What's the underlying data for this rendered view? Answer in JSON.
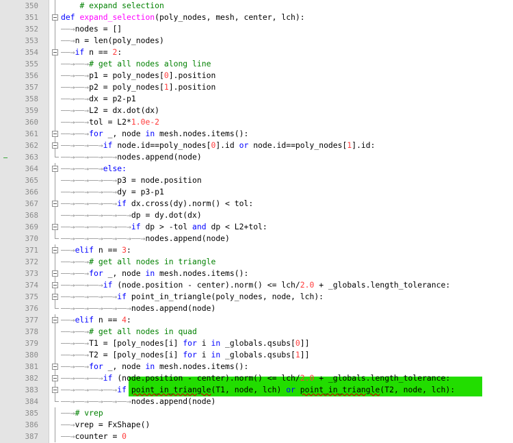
{
  "editor": {
    "lines": [
      {
        "n": "350",
        "fold": "line",
        "tokens": [
          {
            "t": "    ",
            "c": "tx"
          },
          {
            "t": "# expand selection",
            "c": "cm"
          }
        ]
      },
      {
        "n": "351",
        "fold": "box",
        "tokens": [
          {
            "t": "def ",
            "c": "kw"
          },
          {
            "t": "expand_selection",
            "c": "fn"
          },
          {
            "t": "(poly_nodes, mesh, center, lch):",
            "c": "tx"
          }
        ]
      },
      {
        "n": "352",
        "fold": "line",
        "tokens": [
          {
            "t": "——→",
            "c": "arrow"
          },
          {
            "t": "nodes = []",
            "c": "tx"
          }
        ]
      },
      {
        "n": "353",
        "fold": "line",
        "tokens": [
          {
            "t": "——→",
            "c": "arrow"
          },
          {
            "t": "n = len(poly_nodes)",
            "c": "tx"
          }
        ]
      },
      {
        "n": "354",
        "fold": "box",
        "tokens": [
          {
            "t": "——→",
            "c": "arrow"
          },
          {
            "t": "if ",
            "c": "kw"
          },
          {
            "t": "n == ",
            "c": "tx"
          },
          {
            "t": "2",
            "c": "num"
          },
          {
            "t": ":",
            "c": "tx"
          }
        ]
      },
      {
        "n": "355",
        "fold": "line",
        "tokens": [
          {
            "t": "——→——→",
            "c": "arrow"
          },
          {
            "t": "# get all nodes along line",
            "c": "cm"
          }
        ]
      },
      {
        "n": "356",
        "fold": "line",
        "tokens": [
          {
            "t": "——→——→",
            "c": "arrow"
          },
          {
            "t": "p1 = poly_nodes[",
            "c": "tx"
          },
          {
            "t": "0",
            "c": "num"
          },
          {
            "t": "].position",
            "c": "tx"
          }
        ]
      },
      {
        "n": "357",
        "fold": "line",
        "tokens": [
          {
            "t": "——→——→",
            "c": "arrow"
          },
          {
            "t": "p2 = poly_nodes[",
            "c": "tx"
          },
          {
            "t": "1",
            "c": "num"
          },
          {
            "t": "].position",
            "c": "tx"
          }
        ]
      },
      {
        "n": "358",
        "fold": "line",
        "tokens": [
          {
            "t": "——→——→",
            "c": "arrow"
          },
          {
            "t": "dx = p2-p1",
            "c": "tx"
          }
        ]
      },
      {
        "n": "359",
        "fold": "line",
        "tokens": [
          {
            "t": "——→——→",
            "c": "arrow"
          },
          {
            "t": "L2 = dx.dot(dx)",
            "c": "tx"
          }
        ]
      },
      {
        "n": "360",
        "fold": "line",
        "tokens": [
          {
            "t": "——→——→",
            "c": "arrow"
          },
          {
            "t": "tol = L2*",
            "c": "tx"
          },
          {
            "t": "1.0e-2",
            "c": "num"
          }
        ]
      },
      {
        "n": "361",
        "fold": "box",
        "tokens": [
          {
            "t": "——→——→",
            "c": "arrow"
          },
          {
            "t": "for ",
            "c": "kw"
          },
          {
            "t": "_, node ",
            "c": "tx"
          },
          {
            "t": "in ",
            "c": "kw"
          },
          {
            "t": "mesh.nodes.items():",
            "c": "tx"
          }
        ]
      },
      {
        "n": "362",
        "fold": "box",
        "tokens": [
          {
            "t": "——→——→——→",
            "c": "arrow"
          },
          {
            "t": "if ",
            "c": "kw"
          },
          {
            "t": "node.id==poly_nodes[",
            "c": "tx"
          },
          {
            "t": "0",
            "c": "num"
          },
          {
            "t": "].id ",
            "c": "tx"
          },
          {
            "t": "or ",
            "c": "kw"
          },
          {
            "t": "node.id==poly_nodes[",
            "c": "tx"
          },
          {
            "t": "1",
            "c": "num"
          },
          {
            "t": "].id:",
            "c": "tx"
          }
        ]
      },
      {
        "n": "363",
        "fold": "end",
        "tokens": [
          {
            "t": "——→——→——→——→",
            "c": "arrow"
          },
          {
            "t": "nodes.append(node)",
            "c": "tx"
          }
        ]
      },
      {
        "n": "364",
        "fold": "box",
        "tokens": [
          {
            "t": "——→——→——→",
            "c": "arrow"
          },
          {
            "t": "else:",
            "c": "kw"
          }
        ]
      },
      {
        "n": "365",
        "fold": "line",
        "tokens": [
          {
            "t": "——→——→——→——→",
            "c": "arrow"
          },
          {
            "t": "p3 = node.position",
            "c": "tx"
          }
        ]
      },
      {
        "n": "366",
        "fold": "line",
        "tokens": [
          {
            "t": "——→——→——→——→",
            "c": "arrow"
          },
          {
            "t": "dy = p3-p1",
            "c": "tx"
          }
        ]
      },
      {
        "n": "367",
        "fold": "box",
        "tokens": [
          {
            "t": "——→——→——→——→",
            "c": "arrow"
          },
          {
            "t": "if ",
            "c": "kw"
          },
          {
            "t": "dx.cross(dy).norm() < tol:",
            "c": "tx"
          }
        ]
      },
      {
        "n": "368",
        "fold": "line",
        "tokens": [
          {
            "t": "——→——→——→——→——→",
            "c": "arrow"
          },
          {
            "t": "dp = dy.dot(dx)",
            "c": "tx"
          }
        ]
      },
      {
        "n": "369",
        "fold": "box",
        "tokens": [
          {
            "t": "——→——→——→——→——→",
            "c": "arrow"
          },
          {
            "t": "if ",
            "c": "kw"
          },
          {
            "t": "dp > -tol ",
            "c": "tx"
          },
          {
            "t": "and ",
            "c": "kw"
          },
          {
            "t": "dp < L2+tol:",
            "c": "tx"
          }
        ]
      },
      {
        "n": "370",
        "fold": "end",
        "tokens": [
          {
            "t": "——→——→——→——→——→——→",
            "c": "arrow"
          },
          {
            "t": "nodes.append(node)",
            "c": "tx"
          }
        ]
      },
      {
        "n": "371",
        "fold": "box",
        "tokens": [
          {
            "t": "——→",
            "c": "arrow"
          },
          {
            "t": "elif ",
            "c": "kw"
          },
          {
            "t": "n == ",
            "c": "tx"
          },
          {
            "t": "3",
            "c": "num"
          },
          {
            "t": ":",
            "c": "tx"
          }
        ]
      },
      {
        "n": "372",
        "fold": "line",
        "tokens": [
          {
            "t": "——→——→",
            "c": "arrow"
          },
          {
            "t": "# get all nodes in triangle",
            "c": "cm"
          }
        ]
      },
      {
        "n": "373",
        "fold": "box",
        "tokens": [
          {
            "t": "——→——→",
            "c": "arrow"
          },
          {
            "t": "for ",
            "c": "kw"
          },
          {
            "t": "_, node ",
            "c": "tx"
          },
          {
            "t": "in ",
            "c": "kw"
          },
          {
            "t": "mesh.nodes.items():",
            "c": "tx"
          }
        ]
      },
      {
        "n": "374",
        "fold": "box",
        "tokens": [
          {
            "t": "——→——→——→",
            "c": "arrow"
          },
          {
            "t": "if ",
            "c": "kw"
          },
          {
            "t": "(node.position - center).norm() <= lch/",
            "c": "tx"
          },
          {
            "t": "2.0",
            "c": "num"
          },
          {
            "t": " + _globals.length_tolerance:",
            "c": "tx"
          }
        ]
      },
      {
        "n": "375",
        "fold": "box",
        "tokens": [
          {
            "t": "——→——→——→——→",
            "c": "arrow"
          },
          {
            "t": "if ",
            "c": "kw"
          },
          {
            "t": "point_in_triangle(poly_nodes, node, lch):",
            "c": "tx"
          }
        ]
      },
      {
        "n": "376",
        "fold": "end",
        "tokens": [
          {
            "t": "——→——→——→——→——→",
            "c": "arrow"
          },
          {
            "t": "nodes.append(node)",
            "c": "tx"
          }
        ]
      },
      {
        "n": "377",
        "fold": "box",
        "tokens": [
          {
            "t": "——→",
            "c": "arrow"
          },
          {
            "t": "elif ",
            "c": "kw"
          },
          {
            "t": "n == ",
            "c": "tx"
          },
          {
            "t": "4",
            "c": "num"
          },
          {
            "t": ":",
            "c": "tx"
          }
        ]
      },
      {
        "n": "378",
        "fold": "line",
        "tokens": [
          {
            "t": "——→——→",
            "c": "arrow"
          },
          {
            "t": "# get all nodes in quad",
            "c": "cm"
          }
        ]
      },
      {
        "n": "379",
        "fold": "line",
        "tokens": [
          {
            "t": "——→——→",
            "c": "arrow"
          },
          {
            "t": "T1 = [poly_nodes[i] ",
            "c": "tx"
          },
          {
            "t": "for ",
            "c": "kw"
          },
          {
            "t": "i ",
            "c": "tx"
          },
          {
            "t": "in ",
            "c": "kw"
          },
          {
            "t": "_globals.qsubs[",
            "c": "tx"
          },
          {
            "t": "0",
            "c": "num"
          },
          {
            "t": "]]",
            "c": "tx"
          }
        ]
      },
      {
        "n": "380",
        "fold": "line",
        "tokens": [
          {
            "t": "——→——→",
            "c": "arrow"
          },
          {
            "t": "T2 = [poly_nodes[i] ",
            "c": "tx"
          },
          {
            "t": "for ",
            "c": "kw"
          },
          {
            "t": "i ",
            "c": "tx"
          },
          {
            "t": "in ",
            "c": "kw"
          },
          {
            "t": "_globals.qsubs[",
            "c": "tx"
          },
          {
            "t": "1",
            "c": "num"
          },
          {
            "t": "]]",
            "c": "tx"
          }
        ]
      },
      {
        "n": "381",
        "fold": "box",
        "tokens": [
          {
            "t": "——→——→",
            "c": "arrow"
          },
          {
            "t": "for ",
            "c": "kw"
          },
          {
            "t": "_, node ",
            "c": "tx"
          },
          {
            "t": "in ",
            "c": "kw"
          },
          {
            "t": "mesh.nodes.items():",
            "c": "tx"
          }
        ]
      },
      {
        "n": "382",
        "fold": "box",
        "tokens": [
          {
            "t": "——→——→——→",
            "c": "arrow"
          },
          {
            "t": "if ",
            "c": "kw"
          },
          {
            "t": "(node.position - center).norm() <= lch/",
            "c": "tx"
          },
          {
            "t": "2.0",
            "c": "num"
          },
          {
            "t": " + _globals.length_tolerance:",
            "c": "tx"
          }
        ]
      },
      {
        "n": "383",
        "fold": "box",
        "tokens": [
          {
            "t": "——→——→——→——→",
            "c": "arrow"
          },
          {
            "t": "if ",
            "c": "kw"
          },
          {
            "t": "point_in_triangle",
            "c": "ul"
          },
          {
            "t": "(T1, node, lch) ",
            "c": "tx"
          },
          {
            "t": "or ",
            "c": "kw"
          },
          {
            "t": "point_in_triangle",
            "c": "ul"
          },
          {
            "t": "(T2, node, lch):",
            "c": "tx"
          }
        ]
      },
      {
        "n": "384",
        "fold": "end",
        "tokens": [
          {
            "t": "——→——→——→——→——→",
            "c": "arrow"
          },
          {
            "t": "nodes.append(node)",
            "c": "tx"
          }
        ]
      },
      {
        "n": "385",
        "fold": "line",
        "tokens": [
          {
            "t": "——→",
            "c": "arrow"
          },
          {
            "t": "# vrep",
            "c": "cm"
          }
        ]
      },
      {
        "n": "386",
        "fold": "line",
        "tokens": [
          {
            "t": "——→",
            "c": "arrow"
          },
          {
            "t": "vrep = FxShape()",
            "c": "tx"
          }
        ]
      },
      {
        "n": "387",
        "fold": "line",
        "tokens": [
          {
            "t": "——→",
            "c": "arrow"
          },
          {
            "t": "counter = ",
            "c": "tx"
          },
          {
            "t": "0",
            "c": "num"
          }
        ]
      }
    ]
  },
  "colors": {
    "keyword": "#0000ff",
    "comment": "#008000",
    "number": "#ff3a3a",
    "function_name": "#ff00ff",
    "highlight": "#22dd00",
    "gutter": "#e4e4e4"
  }
}
